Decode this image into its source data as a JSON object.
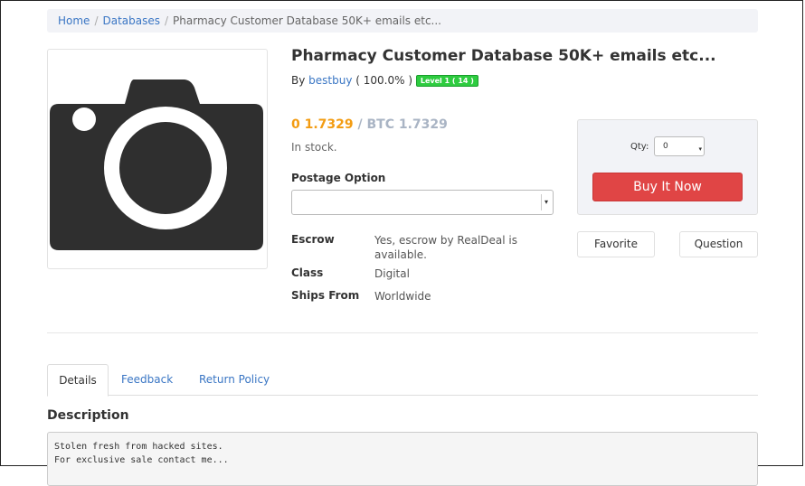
{
  "breadcrumb": {
    "items": [
      "Home",
      "Databases"
    ],
    "current": "Pharmacy Customer Database 50K+ emails etc..."
  },
  "product": {
    "title": "Pharmacy Customer Database 50K+ emails etc...",
    "by_prefix": "By",
    "seller": "bestbuy",
    "rating": "( 100.0% )",
    "level_badge": "Level 1 ( 14 )",
    "price_primary": "0 1.7329",
    "price_secondary": "/ BTC 1.7329",
    "stock": "In stock.",
    "postage_label": "Postage Option",
    "postage_value": ""
  },
  "details": [
    {
      "key": "Escrow",
      "value": "Yes, escrow by RealDeal is available."
    },
    {
      "key": "Class",
      "value": "Digital"
    },
    {
      "key": "Ships From",
      "value": "Worldwide"
    }
  ],
  "buy": {
    "qty_label": "Qty:",
    "qty_value": "0",
    "buy_label": "Buy It Now",
    "favorite_label": "Favorite",
    "question_label": "Question"
  },
  "tabs": [
    {
      "label": "Details",
      "active": true
    },
    {
      "label": "Feedback",
      "active": false
    },
    {
      "label": "Return Policy",
      "active": false
    }
  ],
  "description": {
    "heading": "Description",
    "text": "Stolen fresh from hacked sites.\nFor exclusive sale contact me..."
  },
  "icons": {
    "product_image": "camera-icon",
    "select_arrow": "chevron-down-icon",
    "qty_spinner": "spinner-icon"
  },
  "colors": {
    "link": "#3a76c4",
    "price": "#f39c12",
    "buy_button": "#e04545",
    "level_badge": "#2ecc40"
  }
}
